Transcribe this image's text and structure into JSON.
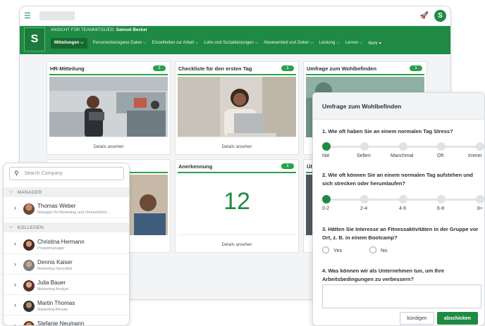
{
  "app": {
    "view_as_prefix": "ANSICHT FÜR TEAMMITGLIED:",
    "view_as_name": "Samuel Becker",
    "logo_letter": "S",
    "user_initial": "S",
    "brand_color": "#1f8a44"
  },
  "nav": {
    "items": [
      {
        "label": "Mitteilungen ⌵",
        "active": true
      },
      {
        "label": "Personenbezogene Daten ⌵"
      },
      {
        "label": "Einzelheiten zur Arbeit ⌵"
      },
      {
        "label": "Lohn und Sozialleistungen ⌵"
      },
      {
        "label": "Abwesenheit und Zeiten ⌵"
      },
      {
        "label": "Leistung ⌵"
      },
      {
        "label": "Lernen ⌵"
      },
      {
        "label": "Mehr ▾"
      }
    ]
  },
  "cards": {
    "hr": {
      "title": "HR-Mitteilung",
      "badge": "1",
      "link": "Details ansehen"
    },
    "checklist": {
      "title": "Checkliste für den ersten Tag",
      "badge": "1",
      "link": "Details ansehen"
    },
    "wellbeing": {
      "title": "Umfrage zum Wohlbefinden",
      "badge": "1"
    },
    "recognition": {
      "title": "Anerkennung",
      "badge": "1",
      "value": "12",
      "link": "Details ansehen"
    },
    "partial_title": "Üb"
  },
  "people": {
    "search_placeholder": "Search Company",
    "manager_header": "MANAGER",
    "colleagues_header": "KOLLEGEN",
    "manager": {
      "name": "Thomas Weber",
      "role": "Manager für Marketing und Verkaufsförd..."
    },
    "colleagues": [
      {
        "name": "Christina Hermann",
        "role": "Projektmanager"
      },
      {
        "name": "Dennis Kaiser",
        "role": "Marketing-Spezialist"
      },
      {
        "name": "Julia Bauer",
        "role": "Marketing-Analyst"
      },
      {
        "name": "Martin Thomas",
        "role": "Marketing-Berater"
      },
      {
        "name": "Stefanie Neumann",
        "role": ""
      }
    ]
  },
  "survey": {
    "title": "Umfrage zum Wohlbefinden",
    "q1": "1. Wie oft haben Sie an einem normalen Tag Stress?",
    "q1_options": [
      "Nie",
      "Selten",
      "Manchmal",
      "Oft",
      "Immer"
    ],
    "q1_selected": 0,
    "q2": "2. Wie oft können Sie an einem normalen Tag aufstehen und sich strecken oder herumlaufen?",
    "q2_options": [
      "0-2",
      "2-4",
      "4-6",
      "6-8",
      "8+"
    ],
    "q2_selected": 0,
    "q3": "3. Hätten Sie Interesse an Fitnessaktivitäten in der Gruppe vor Ort, z. B. in einem Bootcamp?",
    "q3_yes": "Yes",
    "q3_no": "No",
    "q4": "4. Was können wir als Unternehmen tun, um Ihre Arbeitsbedingungen zu verbessern?",
    "cancel_label": "kündigen",
    "submit_label": "abschicken"
  }
}
